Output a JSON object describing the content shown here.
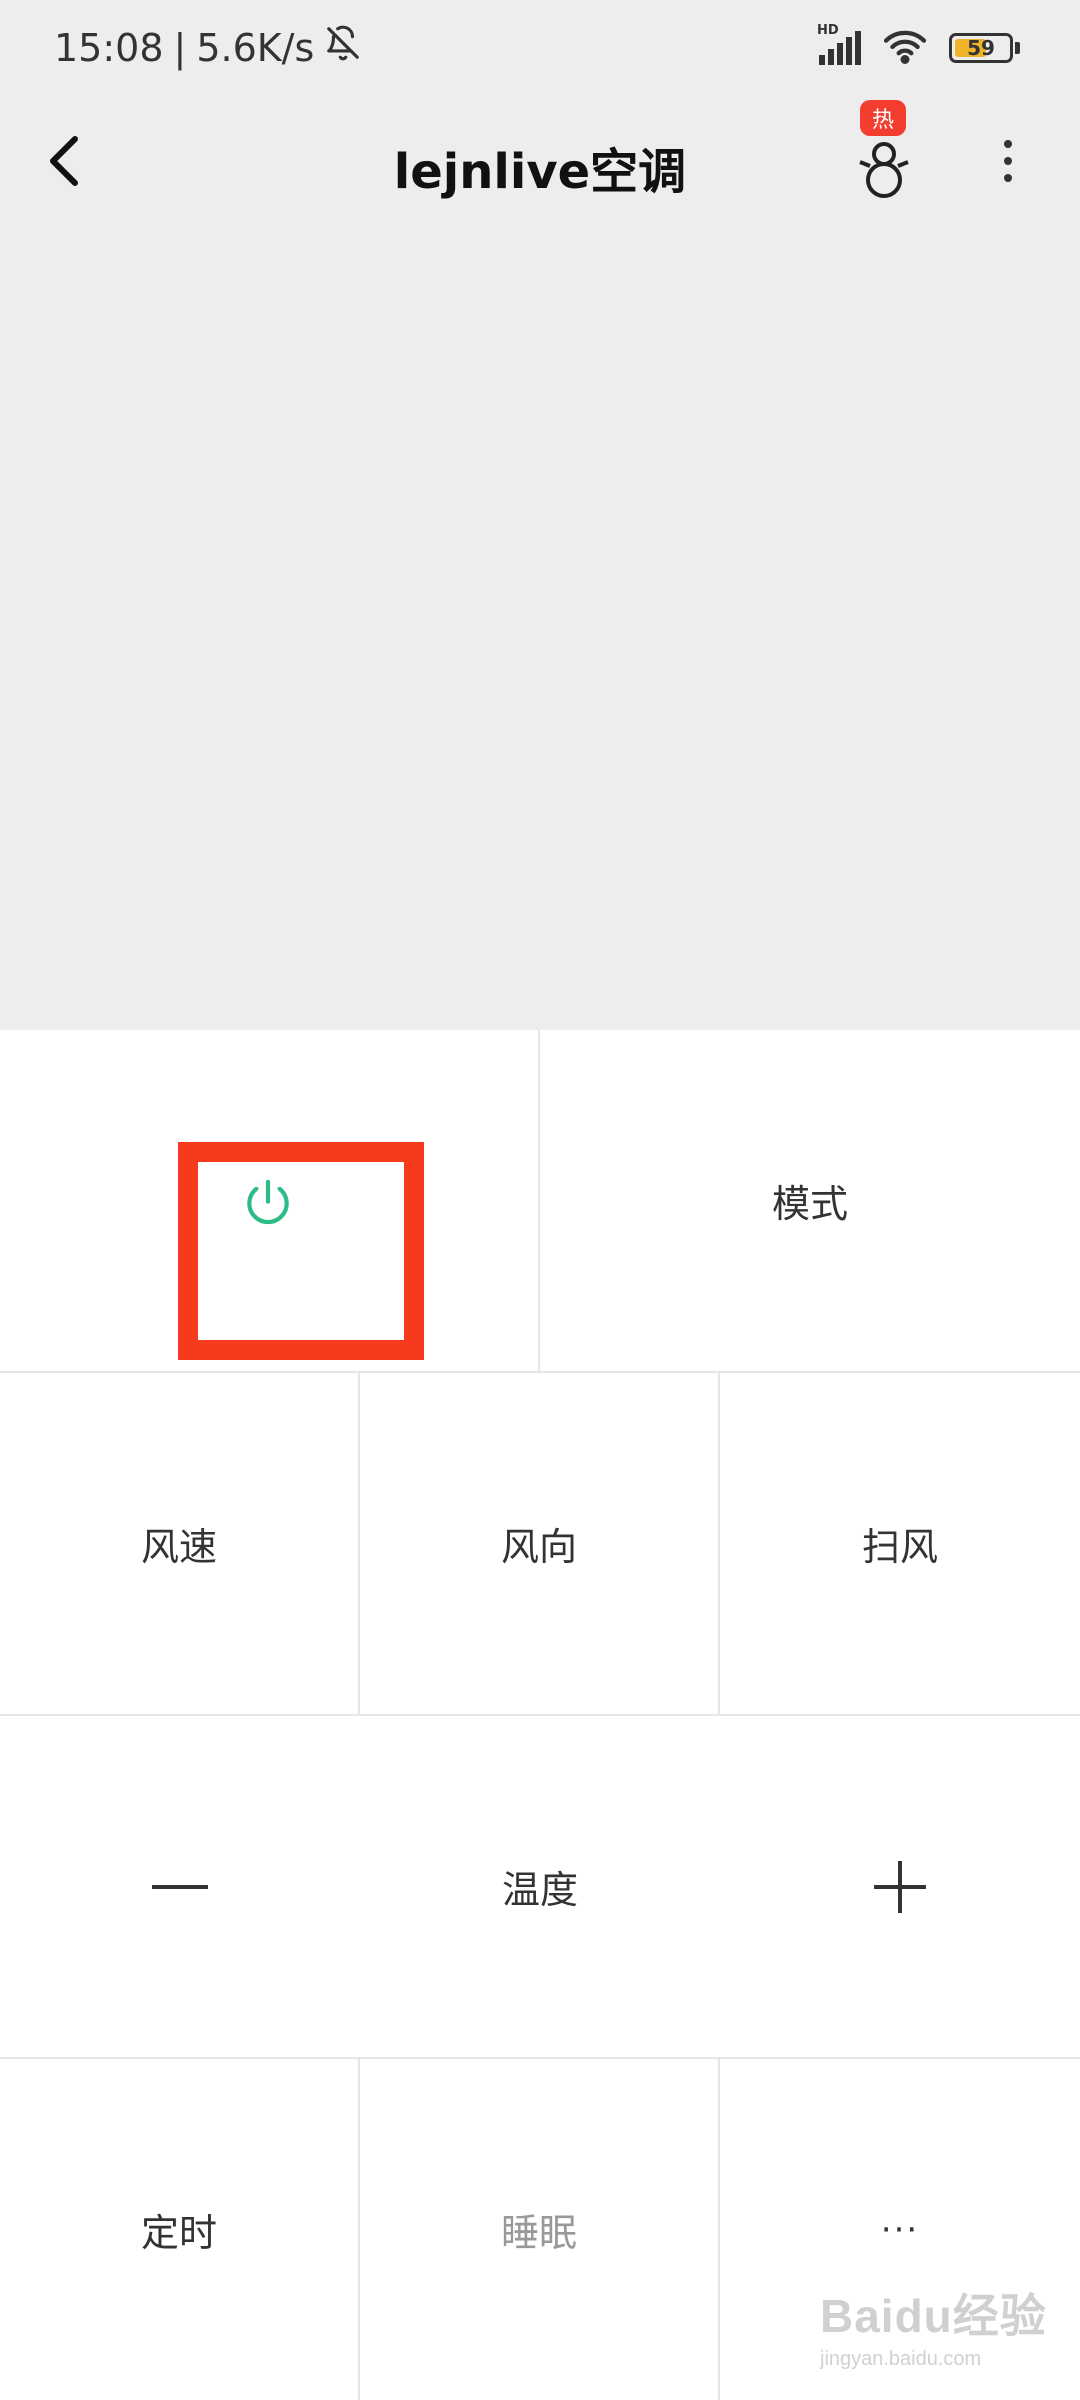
{
  "status_bar": {
    "time": "15:08",
    "separator": "|",
    "net_speed": "5.6K/s",
    "network_label": "HD",
    "battery": "59",
    "battery_level": 0.59
  },
  "navbar": {
    "title": "lejnlive空调",
    "hot_badge": "热",
    "back_icon": "chevron-left-icon",
    "more_icon": "more-vertical-icon"
  },
  "controls": {
    "power_icon": "power-icon",
    "mode": "模式",
    "fan_speed": "风速",
    "fan_direction": "风向",
    "swing": "扫风",
    "temp_minus": "—",
    "temperature": "温度",
    "temp_plus": "+",
    "timer": "定时",
    "sleep": "睡眠",
    "more": "···"
  },
  "colors": {
    "power_accent": "#2dbb86",
    "highlight": "#f53a1e",
    "badge": "#f23d2f"
  },
  "watermark": {
    "main": "Baidu经验",
    "sub": "jingyan.baidu.com"
  }
}
